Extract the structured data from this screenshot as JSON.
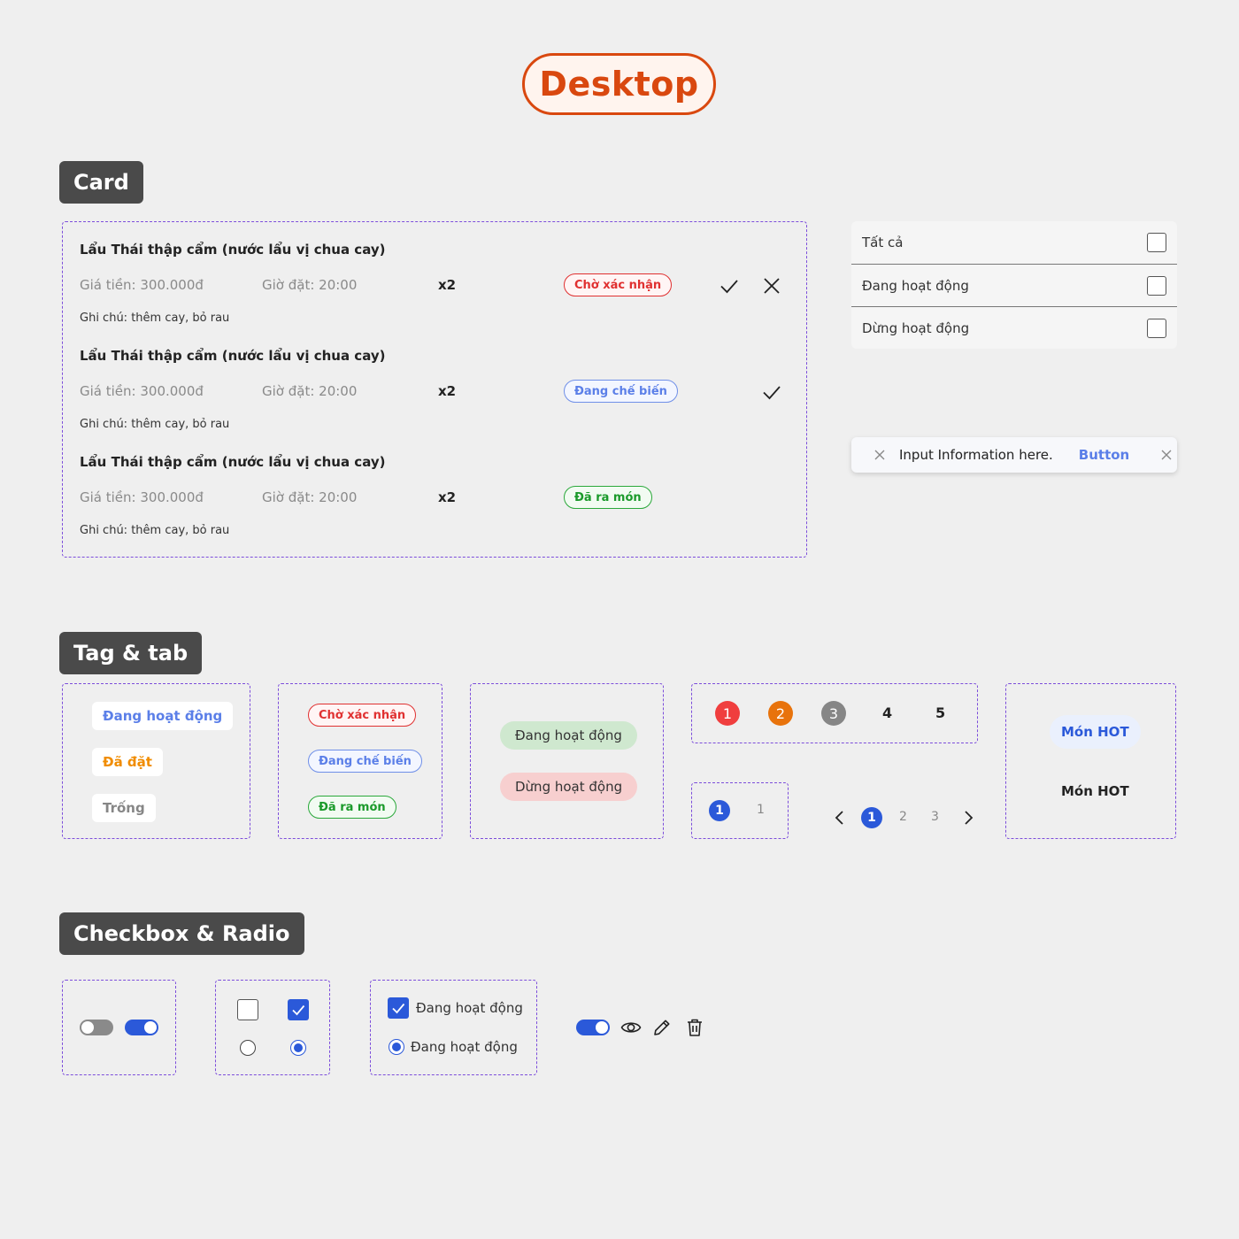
{
  "page_title": "Desktop",
  "sections": {
    "card": "Card",
    "tag_tab": "Tag & tab",
    "checkbox_radio": "Checkbox & Radio"
  },
  "orders": [
    {
      "name": "Lẩu Thái thập cẩm (nước lẩu vị chua cay)",
      "price": "Giá tiền: 300.000đ",
      "time": "Giờ đặt: 20:00",
      "qty": "x2",
      "status": "Chờ xác nhận",
      "note": "Ghi chú: thêm cay, bỏ rau"
    },
    {
      "name": "Lẩu Thái thập cẩm (nước lẩu vị chua cay)",
      "price": "Giá tiền: 300.000đ",
      "time": "Giờ đặt: 20:00",
      "qty": "x2",
      "status": "Đang chế biến",
      "note": "Ghi chú: thêm cay, bỏ rau"
    },
    {
      "name": "Lẩu Thái thập cẩm (nước lẩu vị chua cay)",
      "price": "Giá tiền: 300.000đ",
      "time": "Giờ đặt: 20:00",
      "qty": "x2",
      "status": "Đã ra món",
      "note": "Ghi chú: thêm cay, bỏ rau"
    }
  ],
  "filter": {
    "options": [
      "Tất cả",
      "Đang hoạt động",
      "Dừng hoạt động"
    ]
  },
  "toast": {
    "text": "Input Information here.",
    "button": "Button"
  },
  "tags": {
    "plain": [
      "Đang hoạt động",
      "Đã đặt",
      "Trống"
    ],
    "outlined": [
      "Chờ xác nhận",
      "Đang chế biến",
      "Đã ra món"
    ],
    "pills": [
      "Đang hoạt động",
      "Dừng hoạt động"
    ]
  },
  "steps": {
    "numbers": [
      "1",
      "2",
      "3",
      "4",
      "5"
    ],
    "tab_pair": [
      "1",
      "1"
    ],
    "pagination": [
      "1",
      "2",
      "3"
    ]
  },
  "hot_tabs": [
    "Món HOT",
    "Món HOT"
  ],
  "controls": {
    "checkbox_label": "Đang hoạt động",
    "radio_label": "Đang hoạt động"
  },
  "colors": {
    "accent": "#2b59d9",
    "title_orange": "#d9480f",
    "dashed_border": "#7c4ddb",
    "red": "#e03131",
    "orange": "#f08c00",
    "grey": "#868686"
  }
}
